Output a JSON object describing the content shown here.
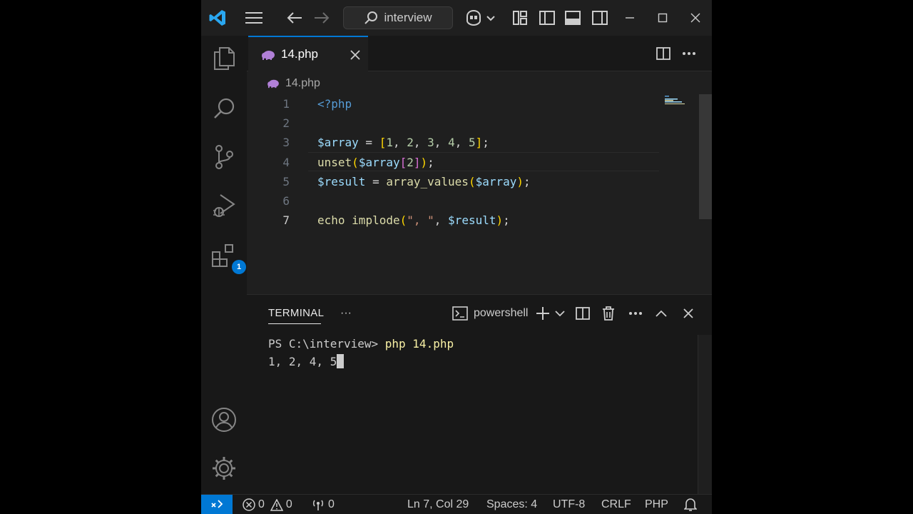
{
  "titlebar": {
    "search_text": "interview"
  },
  "activity": {
    "extensions_badge": "1"
  },
  "tab": {
    "title": "14.php"
  },
  "breadcrumb": {
    "file": "14.php"
  },
  "code": {
    "line_numbers": [
      "1",
      "2",
      "3",
      "4",
      "5",
      "6",
      "7"
    ],
    "active_line": 7
  },
  "panel": {
    "tab_label": "TERMINAL",
    "more": "···",
    "shell_name": "powershell"
  },
  "terminal": {
    "prompt": "PS C:\\interview> ",
    "command": "php 14.php",
    "output": "1, 2, 4, 5"
  },
  "statusbar": {
    "errors": "0",
    "warnings": "0",
    "ports": "0",
    "position": "Ln 7, Col 29",
    "spaces": "Spaces: 4",
    "encoding": "UTF-8",
    "eol": "CRLF",
    "language": "PHP"
  },
  "colors": {
    "accent": "#0078d4",
    "php_icon": "#b180d7"
  }
}
